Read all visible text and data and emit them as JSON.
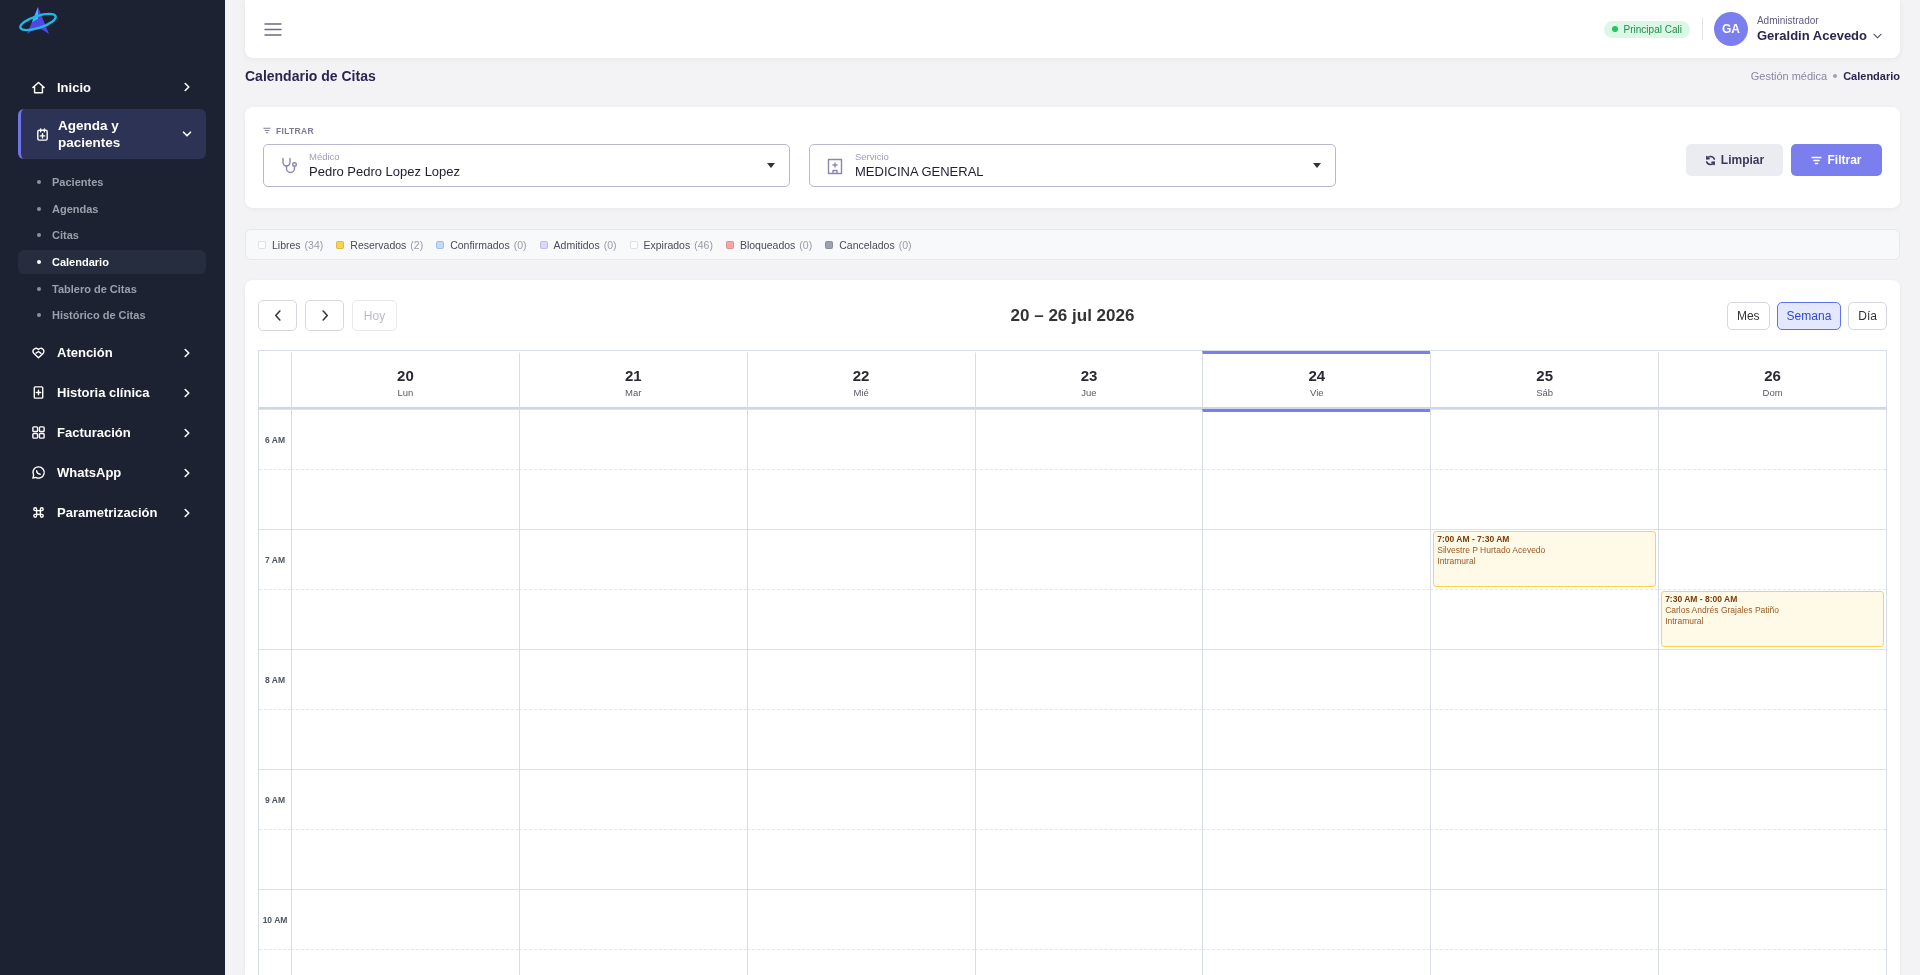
{
  "sidebar": {
    "items": [
      {
        "label": "Inicio",
        "expanded": false
      },
      {
        "label": "Agenda y pacientes",
        "expanded": true,
        "children": [
          {
            "label": "Pacientes",
            "selected": false
          },
          {
            "label": "Agendas",
            "selected": false
          },
          {
            "label": "Citas",
            "selected": false
          },
          {
            "label": "Calendario",
            "selected": true
          },
          {
            "label": "Tablero de Citas",
            "selected": false
          },
          {
            "label": "Histórico de Citas",
            "selected": false
          }
        ]
      },
      {
        "label": "Atención",
        "expanded": false
      },
      {
        "label": "Historia clínica",
        "expanded": false
      },
      {
        "label": "Facturación",
        "expanded": false
      },
      {
        "label": "WhatsApp",
        "expanded": false
      },
      {
        "label": "Parametrización",
        "expanded": false
      }
    ]
  },
  "topbar": {
    "branch": "Principal Cali",
    "user": {
      "initials": "GA",
      "role": "Administrador",
      "name": "Geraldin Acevedo"
    }
  },
  "page": {
    "title": "Calendario de Citas",
    "breadcrumb": [
      "Gestión médica",
      "Calendario"
    ]
  },
  "filter": {
    "title": "FILTRAR",
    "fields": [
      {
        "label": "Médico",
        "value": "Pedro Pedro Lopez Lopez"
      },
      {
        "label": "Servicio",
        "value": "MEDICINA GENERAL"
      }
    ],
    "buttons": [
      {
        "label": "Limpiar",
        "kind": "secondary"
      },
      {
        "label": "Filtrar",
        "kind": "primary"
      }
    ]
  },
  "legend": [
    {
      "label": "Libres",
      "count": "(34)",
      "color": "#ffffff"
    },
    {
      "label": "Reservados",
      "count": "(2)",
      "color": "#fcd34d"
    },
    {
      "label": "Confirmados",
      "count": "(0)",
      "color": "#bfdbfe"
    },
    {
      "label": "Admitidos",
      "count": "(0)",
      "color": "#ddd6fe"
    },
    {
      "label": "Expirados",
      "count": "(46)",
      "color": "#ffffff"
    },
    {
      "label": "Bloqueados",
      "count": "(0)",
      "color": "#fca5a5"
    },
    {
      "label": "Cancelados",
      "count": "(0)",
      "color": "#9ca3af"
    }
  ],
  "calendar": {
    "title": "20 – 26 jul 2026",
    "today_button": {
      "label": "Hoy",
      "disabled": true
    },
    "views": [
      {
        "label": "Mes",
        "selected": false
      },
      {
        "label": "Semana",
        "selected": true
      },
      {
        "label": "Día",
        "selected": false
      }
    ],
    "days": [
      {
        "number": "20",
        "name": "Lun",
        "today": false
      },
      {
        "number": "21",
        "name": "Mar",
        "today": false
      },
      {
        "number": "22",
        "name": "Mié",
        "today": false
      },
      {
        "number": "23",
        "name": "Jue",
        "today": false
      },
      {
        "number": "24",
        "name": "Vie",
        "today": true
      },
      {
        "number": "25",
        "name": "Sáb",
        "today": false
      },
      {
        "number": "26",
        "name": "Dom",
        "today": false
      }
    ],
    "rows": [
      {
        "label": "6 AM",
        "cells": [
          {
            "kind": "empty"
          },
          {
            "kind": "empty"
          },
          {
            "kind": "empty"
          },
          {
            "kind": "empty"
          },
          {
            "kind": "empty"
          },
          {
            "kind": "empty"
          },
          {
            "kind": "empty"
          }
        ]
      },
      {
        "cells": [
          {
            "kind": "empty"
          },
          {
            "kind": "empty"
          },
          {
            "kind": "empty"
          },
          {
            "kind": "empty"
          },
          {
            "kind": "empty"
          },
          {
            "kind": "empty"
          },
          {
            "kind": "empty"
          }
        ]
      },
      {
        "label": "7 AM",
        "cells": [
          {
            "kind": "empty"
          },
          {
            "kind": "empty"
          },
          {
            "kind": "empty"
          },
          {
            "kind": "empty"
          },
          {
            "kind": "empty"
          },
          {
            "kind": "appointment",
            "time": "7:00 AM - 7:30 AM",
            "patient": "Silvestre P Hurtado Acevedo",
            "type": "Intramural",
            "color": "#fcd34d"
          },
          {
            "kind": "empty"
          }
        ]
      },
      {
        "cells": [
          {
            "kind": "empty"
          },
          {
            "kind": "empty"
          },
          {
            "kind": "empty"
          },
          {
            "kind": "empty"
          },
          {
            "kind": "empty"
          },
          {
            "kind": "empty"
          },
          {
            "kind": "appointment",
            "time": "7:30 AM - 8:00 AM",
            "patient": "Carlos Andrés Grajales Patiño",
            "type": "Intramural",
            "color": "#fcd34d"
          }
        ]
      },
      {
        "label": "8 AM",
        "cells": [
          {
            "kind": "empty"
          },
          {
            "kind": "empty"
          },
          {
            "kind": "empty"
          },
          {
            "kind": "empty"
          },
          {
            "kind": "empty"
          },
          {
            "kind": "empty"
          },
          {
            "kind": "empty"
          }
        ]
      },
      {
        "cells": [
          {
            "kind": "empty"
          },
          {
            "kind": "empty"
          },
          {
            "kind": "empty"
          },
          {
            "kind": "empty"
          },
          {
            "kind": "empty"
          },
          {
            "kind": "empty"
          },
          {
            "kind": "empty"
          }
        ]
      },
      {
        "label": "9 AM",
        "cells": [
          {
            "kind": "empty"
          },
          {
            "kind": "empty"
          },
          {
            "kind": "empty"
          },
          {
            "kind": "empty"
          },
          {
            "kind": "empty"
          },
          {
            "kind": "empty"
          },
          {
            "kind": "empty"
          }
        ]
      },
      {
        "cells": [
          {
            "kind": "empty"
          },
          {
            "kind": "empty"
          },
          {
            "kind": "empty"
          },
          {
            "kind": "empty"
          },
          {
            "kind": "empty"
          },
          {
            "kind": "empty"
          },
          {
            "kind": "empty"
          }
        ]
      },
      {
        "label": "10 AM",
        "cells": [
          {
            "kind": "empty"
          },
          {
            "kind": "empty"
          },
          {
            "kind": "empty"
          },
          {
            "kind": "empty"
          },
          {
            "kind": "empty"
          },
          {
            "kind": "empty"
          },
          {
            "kind": "empty"
          }
        ]
      },
      {
        "cells": [
          {
            "kind": "empty"
          },
          {
            "kind": "empty"
          },
          {
            "kind": "empty"
          },
          {
            "kind": "empty"
          },
          {
            "kind": "empty"
          },
          {
            "kind": "empty"
          },
          {
            "kind": "empty"
          }
        ]
      }
    ]
  }
}
